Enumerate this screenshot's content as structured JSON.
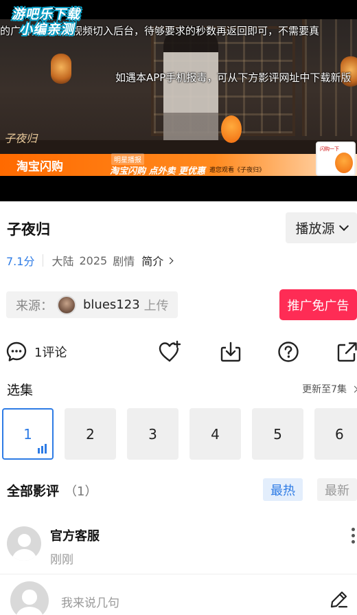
{
  "player": {
    "watermark_line1": "游吧乐下载",
    "watermark_line2": "小编亲测",
    "marquee_top": "的广告，请将本视频切入后台，待够要求的秒数再返回即可，不需要真",
    "marquee_mid": "如遇本APP手机报毒，可从下方影评网址中下载新版",
    "ad_brand": "淘宝闪购",
    "ad_tag": "明星播报",
    "ad_slogan": "淘宝闪购 点外卖 更优惠",
    "ad_note": "邀您观看《子夜归》",
    "ad_thumb_text": "闪购一下",
    "show_logo": "子夜归"
  },
  "info": {
    "title": "子夜归",
    "source_button": "播放源",
    "score": "7.1分",
    "region": "大陆",
    "year": "2025",
    "genre": "剧情",
    "intro_link": "简介"
  },
  "uploader": {
    "label": "来源：",
    "name": "blues123",
    "suffix": "上传"
  },
  "promo_button": "推广免广告",
  "actions": {
    "comment_count": "1评论"
  },
  "episodes": {
    "header": "选集",
    "update_status": "更新至7集",
    "items": [
      "1",
      "2",
      "3",
      "4",
      "5",
      "6"
    ],
    "active_index": 0
  },
  "reviews": {
    "header": "全部影评",
    "count": "（1）",
    "sort_hot": "最热",
    "sort_new": "最新",
    "items": [
      {
        "author": "官方客服",
        "time": "刚刚"
      }
    ]
  },
  "composer": {
    "placeholder": "我来说几句"
  },
  "colors": {
    "accent_blue": "#2d7be5",
    "promo_red": "#fe2c55"
  }
}
